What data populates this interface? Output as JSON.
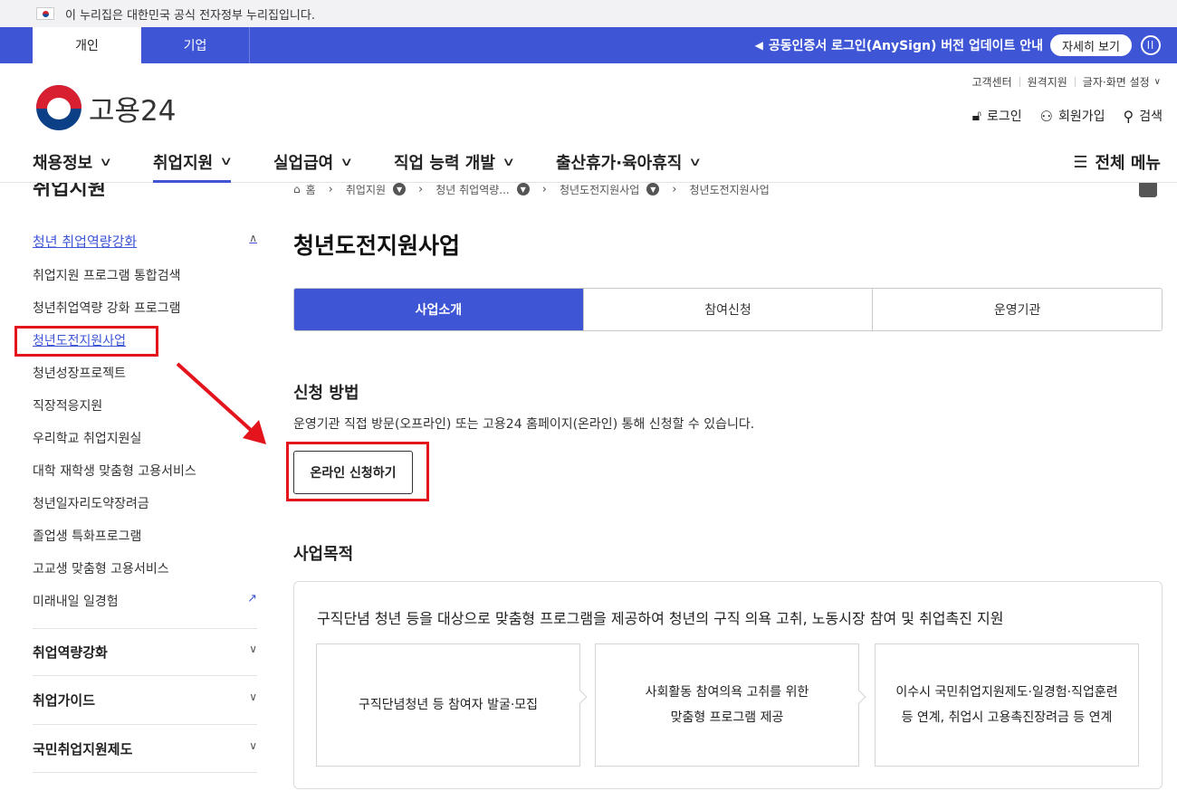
{
  "gov_banner": {
    "text": "이 누리집은 대한민국 공식 전자정부 누리집입니다."
  },
  "topbar": {
    "tabs": [
      {
        "label": "개인"
      },
      {
        "label": "기업"
      }
    ],
    "notice": "공동인증서 로그인(AnySign) 버전 업데이트 안내",
    "detail_label": "자세히 보기"
  },
  "logo": {
    "text": "고용24"
  },
  "util_links": [
    "고객센터",
    "원격지원",
    "글자·화면 설정"
  ],
  "account": {
    "login": "로그인",
    "signup": "회원가입",
    "search": "검색"
  },
  "gnb": {
    "items": [
      "채용정보",
      "취업지원",
      "실업급여",
      "직업 능력 개발",
      "출산휴가·육아휴직"
    ],
    "active_index": 1,
    "all_menu": "전체 메뉴"
  },
  "lnb": {
    "title": "취업지원",
    "open_group": "청년 취업역량강화",
    "sub_items": [
      "취업지원 프로그램 통합검색",
      "청년취업역량 강화 프로그램",
      "청년도전지원사업",
      "청년성장프로젝트",
      "직장적응지원",
      "우리학교 취업지원실",
      "대학 재학생 맞춤형 고용서비스",
      "청년일자리도약장려금",
      "졸업생 특화프로그램",
      "고교생 맞춤형 고용서비스",
      "미래내일 일경험"
    ],
    "current_index": 2,
    "groups": [
      "취업역량강화",
      "취업가이드",
      "국민취업지원제도"
    ]
  },
  "breadcrumb": [
    "홈",
    "취업지원",
    "청년 취업역량...",
    "청년도전지원사업",
    "청년도전지원사업"
  ],
  "page": {
    "title": "청년도전지원사업",
    "tabs": [
      "사업소개",
      "참여신청",
      "운영기관"
    ],
    "active_tab": 0
  },
  "apply": {
    "heading": "신청 방법",
    "description": "운영기관 직접 방문(오프라인) 또는 고용24 홈페이지(온라인) 통해 신청할 수 있습니다.",
    "button": "온라인 신청하기"
  },
  "purpose": {
    "heading": "사업목적",
    "summary": "구직단념 청년 등을 대상으로 맞춤형 프로그램을 제공하여 청년의 구직 의욕 고취, 노동시장 참여 및 취업촉진 지원",
    "steps": [
      {
        "line1": "구직단념청년 등 참여자 발굴·모집",
        "line2": ""
      },
      {
        "line1": "사회활동 참여의욕 고취를 위한",
        "line2": "맞춤형 프로그램 제공"
      },
      {
        "line1": "이수시 국민취업지원제도·일경험·직업훈련",
        "line2": "등 연계, 취업시 고용촉진장려금 등 연계"
      }
    ]
  },
  "colors": {
    "primary": "#3e56d6",
    "highlight": "#e3141b"
  },
  "icons": [
    "flag-icon",
    "megaphone-icon",
    "pause-icon",
    "lock-icon",
    "user-plus-icon",
    "search-icon",
    "menu-icon",
    "home-icon",
    "print-icon",
    "external-link-icon",
    "chevron-down-icon",
    "chevron-up-icon",
    "arrow-annotation"
  ]
}
